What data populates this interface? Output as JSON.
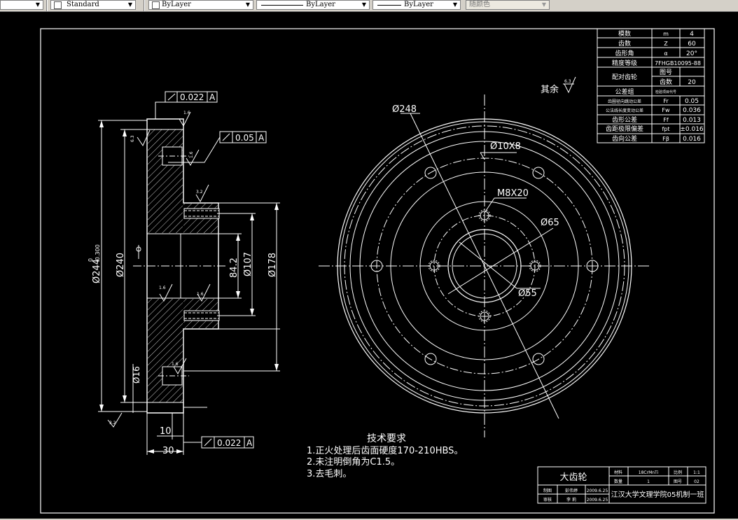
{
  "toolbar": {
    "text_style": "Standard",
    "color": "ByLayer",
    "linetype": "ByLayer",
    "lineweight": "ByLayer",
    "plot_style": "随颜色"
  },
  "section_view": {
    "tol_top": "0.022",
    "tol_top_datum": "A",
    "tol_mid": "0.05",
    "tol_mid_datum": "A",
    "tol_bottom": "0.022",
    "tol_bottom_datum": "A",
    "dim_outer": "Ø244",
    "dim_outer_tol_upper": "0",
    "dim_outer_tol_lower": "-0.300",
    "dim_240": "Ø240",
    "dim_84": "84.2",
    "dim_107": "Ø107",
    "dim_178": "Ø178",
    "dim_16": "Ø16",
    "dim_10": "10",
    "dim_30": "30",
    "rough_16a": "1.6",
    "rough_63": "6.3",
    "rough_32": "3.2",
    "rough_16b": "1.6",
    "rough_16c": "1.6",
    "rough_16d": "1.6",
    "rough_32b": "3.2",
    "rough_side": "1.6"
  },
  "front_view": {
    "dim_248": "Ø248",
    "dim_10x8": "Ø10X8",
    "dim_m8": "M8X20",
    "dim_65": "Ø65",
    "dim_55": "Ø55",
    "rest_label": "其余",
    "rest_value": "6.3"
  },
  "param_table": {
    "rows": [
      {
        "name": "模数",
        "sym": "m",
        "val": "4"
      },
      {
        "name": "齿数",
        "sym": "Z",
        "val": "60"
      },
      {
        "name": "齿形角",
        "sym": "α",
        "val": "20°"
      },
      {
        "name": "精度等级",
        "sym": "7FHGB10095-88",
        "val": ""
      },
      {
        "name": "配对齿轮",
        "sym": "图号",
        "val": ""
      },
      {
        "name": "",
        "sym": "齿数",
        "val": "20"
      },
      {
        "name": "公差组",
        "sym": "检验项目代号",
        "val": ""
      },
      {
        "name": "齿圈径向跳动公差",
        "sym": "Fr",
        "val": "0.05"
      },
      {
        "name": "公法线长度变动公差",
        "sym": "Fw",
        "val": "0.036"
      },
      {
        "name": "齿形公差",
        "sym": "Ff",
        "val": "0.013"
      },
      {
        "name": "齿距极限偏差",
        "sym": "fpt",
        "val": "±0.016"
      },
      {
        "name": "齿向公差",
        "sym": "Fβ",
        "val": "0.016"
      }
    ]
  },
  "tech_req": {
    "title": "技术要求",
    "lines": [
      "1.正火处理后齿面硬度170-210HBS。",
      "2.未注明倒角为C1.5。",
      "3.去毛刺。"
    ]
  },
  "title_block": {
    "part_name": "大齿轮",
    "material_label": "材料",
    "material": "18CrMnTi",
    "scale_label": "比例",
    "scale": "1:1",
    "qty_label": "数量",
    "qty": "1",
    "drawing_no_label": "图号",
    "drawing_no": "02",
    "drawn_label": "制图",
    "drawn_name": "彭伟婷",
    "drawn_date": "2009.6.25",
    "checked_label": "审核",
    "checked_name": "李 莉",
    "checked_date": "2009.6.25",
    "school": "江汉大学文理学院05机制一班"
  },
  "colors": {
    "background": "#000000",
    "line": "#ffffff",
    "toolbar": "#d4d0c8"
  }
}
